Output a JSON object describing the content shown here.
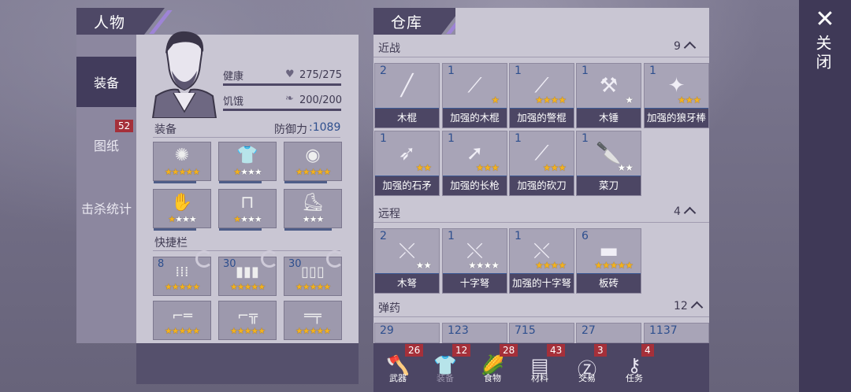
{
  "character": {
    "title": "人物",
    "tabs": [
      {
        "label": "装备",
        "active": true
      },
      {
        "label": "图纸",
        "badge": "52"
      },
      {
        "label": "击杀统计"
      }
    ],
    "stats": {
      "health_label": "健康",
      "health_value": "275/275",
      "hunger_label": "饥饿",
      "hunger_value": "200/200"
    },
    "equipment_label": "装备",
    "defense_label": "防御力",
    "defense_value": "1089",
    "equipment": [
      {
        "icon": "saw-blade-icon",
        "stars": 5,
        "gold": 5
      },
      {
        "icon": "shirt-icon",
        "stars": 4,
        "gold": 1
      },
      {
        "icon": "brain-helmet-icon",
        "stars": 5,
        "gold": 5
      },
      {
        "icon": "gloves-icon",
        "stars": 4,
        "gold": 1
      },
      {
        "icon": "pants-icon",
        "stars": 4,
        "gold": 1
      },
      {
        "icon": "boots-icon",
        "stars": 3,
        "gold": 0
      }
    ],
    "quickbar_label": "快捷栏",
    "quickbar": [
      {
        "count": "8",
        "icon": "bullets-icon",
        "stars": 5
      },
      {
        "count": "30",
        "icon": "shells-icon",
        "stars": 5
      },
      {
        "count": "30",
        "icon": "magazine-icon",
        "stars": 5
      },
      {
        "count": "",
        "icon": "shotgun-icon",
        "stars": 5
      },
      {
        "count": "",
        "icon": "revolver-icon",
        "stars": 5
      },
      {
        "count": "",
        "icon": "rifle-icon",
        "stars": 5
      }
    ]
  },
  "warehouse": {
    "title": "仓库",
    "sections": [
      {
        "label": "近战",
        "count": "9",
        "items": [
          {
            "count": "2",
            "name": "木棍",
            "stars": 0,
            "icon": "wooden-stick-icon"
          },
          {
            "count": "1",
            "name": "加强的木棍",
            "stars": 1,
            "icon": "reinforced-stick-icon"
          },
          {
            "count": "1",
            "name": "加强的警棍",
            "stars": 4,
            "icon": "baton-icon"
          },
          {
            "count": "1",
            "name": "木锤",
            "stars": 1,
            "white": true,
            "icon": "hammer-icon"
          },
          {
            "count": "1",
            "name": "加强的狼牙棒",
            "stars": 3,
            "icon": "mace-icon"
          },
          {
            "count": "1",
            "name": "加强的石矛",
            "stars": 2,
            "icon": "stone-spear-icon"
          },
          {
            "count": "1",
            "name": "加强的长枪",
            "stars": 3,
            "icon": "lance-icon"
          },
          {
            "count": "1",
            "name": "加强的砍刀",
            "stars": 3,
            "icon": "machete-icon"
          },
          {
            "count": "1",
            "name": "菜刀",
            "stars": 2,
            "white": true,
            "icon": "cleaver-icon"
          }
        ]
      },
      {
        "label": "远程",
        "count": "4",
        "items": [
          {
            "count": "2",
            "name": "木弩",
            "stars": 2,
            "white": true,
            "icon": "wooden-crossbow-icon"
          },
          {
            "count": "1",
            "name": "十字弩",
            "stars": 4,
            "white": true,
            "icon": "crossbow-icon"
          },
          {
            "count": "1",
            "name": "加强的十字弩",
            "stars": 4,
            "icon": "reinforced-crossbow-icon"
          },
          {
            "count": "6",
            "name": "板砖",
            "stars": 5,
            "icon": "brick-icon"
          }
        ]
      },
      {
        "label": "弹药",
        "count": "12",
        "items": [
          {
            "count": "29"
          },
          {
            "count": "123"
          },
          {
            "count": "715"
          },
          {
            "count": "27"
          },
          {
            "count": "1137"
          }
        ]
      }
    ],
    "bottom_tabs": [
      {
        "label": "武器",
        "badge": "26",
        "icon": "axe-icon"
      },
      {
        "label": "装备",
        "badge": "12",
        "icon": "shirt-icon",
        "active": true
      },
      {
        "label": "食物",
        "badge": "28",
        "icon": "corn-icon"
      },
      {
        "label": "材料",
        "badge": "43",
        "icon": "wood-planks-icon"
      },
      {
        "label": "交易",
        "badge": "3",
        "icon": "coin-icon"
      },
      {
        "label": "任务",
        "badge": "4",
        "icon": "key-icon"
      }
    ]
  },
  "close_label": "关闭"
}
